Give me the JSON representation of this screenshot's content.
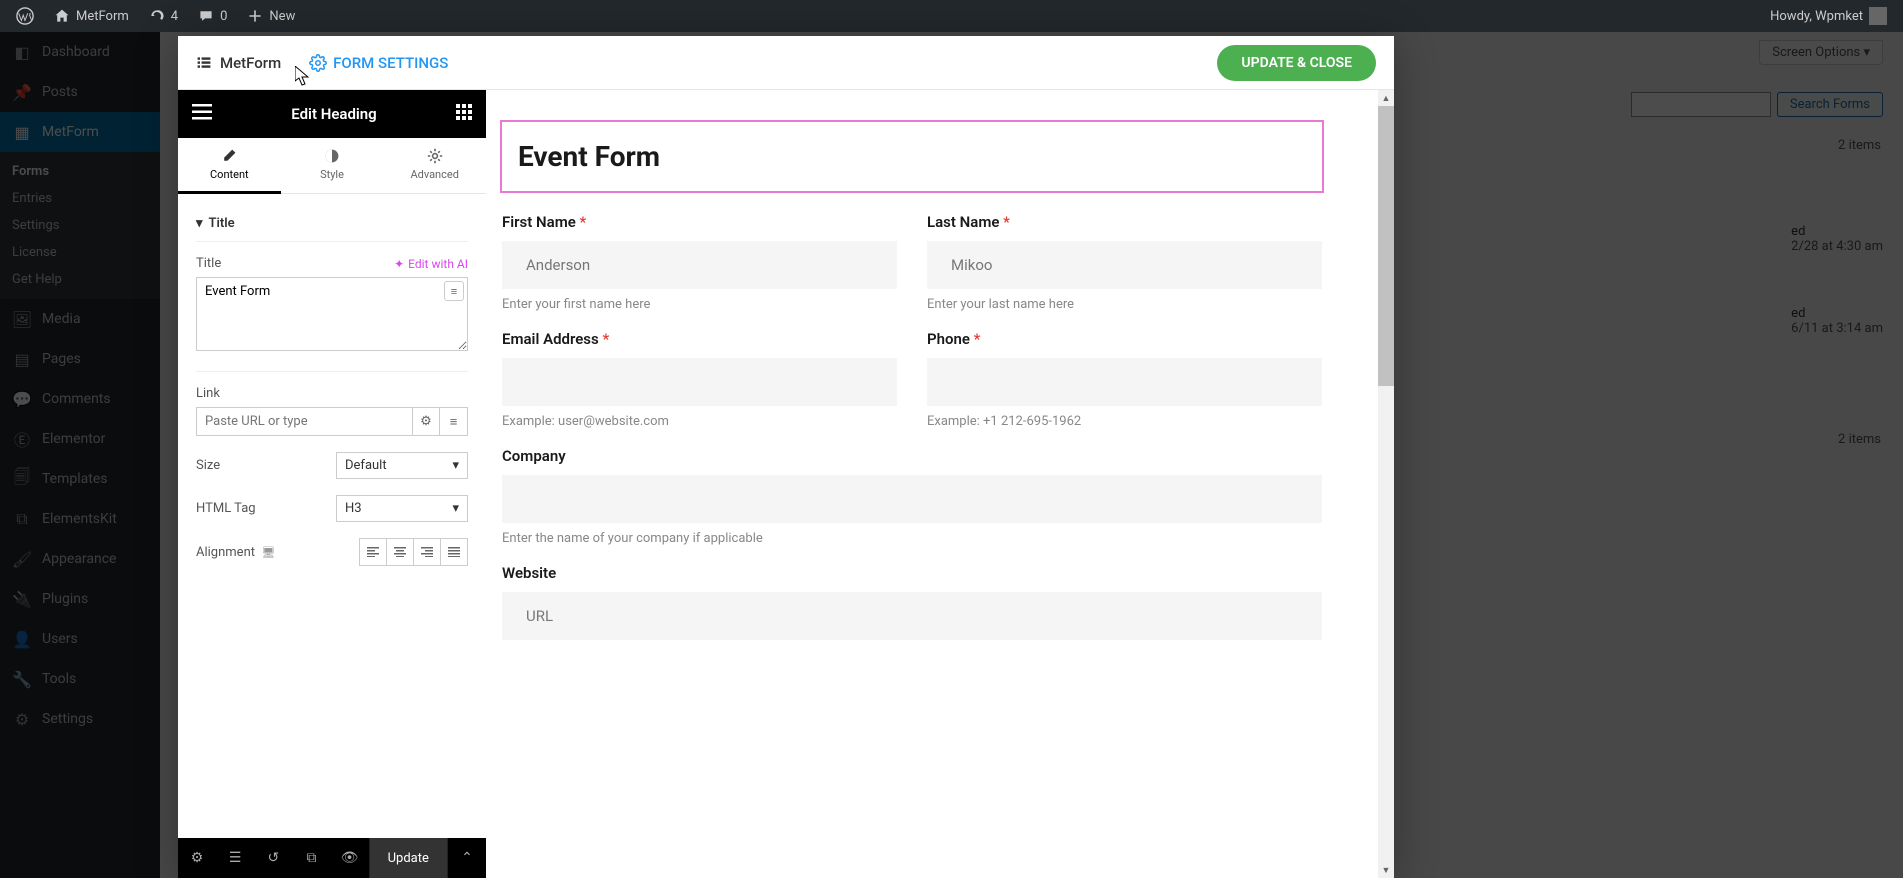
{
  "adminbar": {
    "site_name": "MetForm",
    "updates": "4",
    "comments": "0",
    "new": "New",
    "howdy": "Howdy, Wpmket"
  },
  "sidebar": {
    "dashboard": "Dashboard",
    "posts": "Posts",
    "metform": "MetForm",
    "metform_sub": {
      "forms": "Forms",
      "entries": "Entries",
      "settings": "Settings",
      "license": "License",
      "gethelp": "Get Help"
    },
    "media": "Media",
    "pages": "Pages",
    "comments": "Comments",
    "elementor": "Elementor",
    "templates": "Templates",
    "elementskit": "ElementsKit",
    "appearance": "Appearance",
    "plugins": "Plugins",
    "users": "Users",
    "tools": "Tools",
    "settings": "Settings"
  },
  "back": {
    "screen_options": "Screen Options",
    "search_btn": "Search Forms",
    "items": "2 items",
    "row1_status": "ed",
    "row1_date": "2/28 at 4:30 am",
    "row2_status": "ed",
    "row2_date": "6/11 at 3:14 am"
  },
  "modal": {
    "brand": "MetForm",
    "form_settings": "FORM SETTINGS",
    "update_close": "UPDATE & CLOSE"
  },
  "panel": {
    "title": "Edit Heading",
    "tabs": {
      "content": "Content",
      "style": "Style",
      "advanced": "Advanced"
    },
    "section_title": "Title",
    "title_label": "Title",
    "ai_link": "Edit with AI",
    "title_value": "Event Form",
    "link_label": "Link",
    "link_placeholder": "Paste URL or type",
    "size_label": "Size",
    "size_value": "Default",
    "htmltag_label": "HTML Tag",
    "htmltag_value": "H3",
    "alignment_label": "Alignment",
    "footer_update": "Update"
  },
  "preview": {
    "heading": "Event Form",
    "first_name": {
      "label": "First Name",
      "placeholder": "Anderson",
      "help": "Enter your first name here"
    },
    "last_name": {
      "label": "Last Name",
      "placeholder": "Mikoo",
      "help": "Enter your last name here"
    },
    "email": {
      "label": "Email Address",
      "help": "Example: user@website.com"
    },
    "phone": {
      "label": "Phone",
      "help": "Example: +1 212-695-1962"
    },
    "company": {
      "label": "Company",
      "help": "Enter the name of your company if applicable"
    },
    "website": {
      "label": "Website",
      "placeholder": "URL"
    }
  }
}
